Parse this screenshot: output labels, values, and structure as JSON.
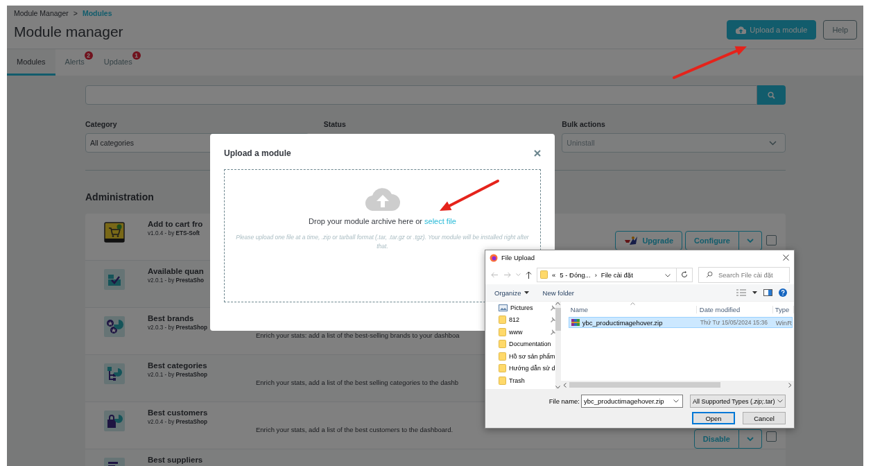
{
  "breadcrumb": [
    {
      "label": "Module Manager",
      "current": false
    },
    {
      "label": "Modules",
      "current": true
    }
  ],
  "breadcrumb_separator": ">",
  "title": "Module manager",
  "header_buttons": [
    {
      "label": "Upload a module",
      "kind": "primary"
    },
    {
      "label": "Help",
      "kind": "outline"
    }
  ],
  "tabs": [
    {
      "label": "Modules",
      "selected": true
    },
    {
      "label": "Alerts",
      "selected": false,
      "badge": "2"
    },
    {
      "label": "Updates",
      "selected": false,
      "badge": "1"
    }
  ],
  "filters": [
    {
      "label": "Category",
      "value": "All categories",
      "disabled": false
    },
    {
      "label": "Status"
    },
    {
      "label": "Bulk actions",
      "value": "Uninstall",
      "disabled": true
    }
  ],
  "section_title": "Administration",
  "modules": [
    {
      "name": "Add to cart fro",
      "version": "v1.0.4 - by **ETS-Soft**",
      "actions": [
        {
          "label": "Upgrade",
          "kind": "upgrade"
        },
        {
          "label": "Configure",
          "kind": "split"
        }
      ],
      "checked": false
    },
    {
      "name": "Available quan",
      "version": "v2.0.1 - by **PrestaSho**"
    },
    {
      "name": "Best brands",
      "version": "v2.0.3 - by **PrestaShop**",
      "description": "Enrich your stats: add a list of the best-selling brands to your dashboa"
    },
    {
      "name": "Best categories",
      "version": "v2.0.1 - by **PrestaShop**",
      "description": "Enrich your stats, add a list of the best selling categories to the dashb"
    },
    {
      "name": "Best customers",
      "version": "v2.0.4 - by **PrestaShop**",
      "description": "Enrich your stats, add a list of the best customers to the dashboard.",
      "actions": [
        {
          "label": "Disable",
          "kind": "split"
        }
      ],
      "checked": false
    },
    {
      "name": "Best suppliers"
    }
  ],
  "upload_modal": {
    "title": "Upload a module",
    "drop_text": "Drop your module archive here or",
    "link": "select file",
    "hint": "Please upload one file at a time, .zip or tarball format (.tar, .tar.gz or .tgz). Your module will be installed right after that."
  },
  "file_dialog": {
    "title": "File Upload",
    "path_prefix": "«",
    "path": [
      "5 - Đóng...",
      "File cài đặt"
    ],
    "path_separator": "›",
    "search_placeholder": "Search File cài đặt",
    "toolbar": [
      {
        "label": "Organize",
        "kind": "menu"
      },
      {
        "label": "New folder",
        "kind": "button"
      }
    ],
    "nav_items": [
      {
        "label": "Pictures",
        "kind": "pictures",
        "pinned": true
      },
      {
        "label": "812",
        "kind": "folder",
        "pinned": true
      },
      {
        "label": "www",
        "kind": "folder",
        "pinned": true
      },
      {
        "label": "Documentation",
        "kind": "folder",
        "pinned": false
      },
      {
        "label": "Hồ sơ sản phẩm",
        "kind": "folder",
        "pinned": false
      },
      {
        "label": "Hướng dẫn sử d",
        "kind": "folder",
        "pinned": false
      },
      {
        "label": "Trash",
        "kind": "folder",
        "pinned": false
      }
    ],
    "columns": [
      "Name",
      "Date modified",
      "Type"
    ],
    "files": [
      {
        "name": "ybc_productimagehover.zip",
        "date": "Thứ Tư 15/05/2024 15:36",
        "type": "WinR",
        "selected": true
      }
    ],
    "filename_label": "File name:",
    "filename": "ybc_productimagehover.zip",
    "filetype": "All Supported Types (*.zip;*.tar)",
    "buttons": [
      {
        "label": "Open",
        "default": true
      },
      {
        "label": "Cancel",
        "default": false
      }
    ]
  }
}
